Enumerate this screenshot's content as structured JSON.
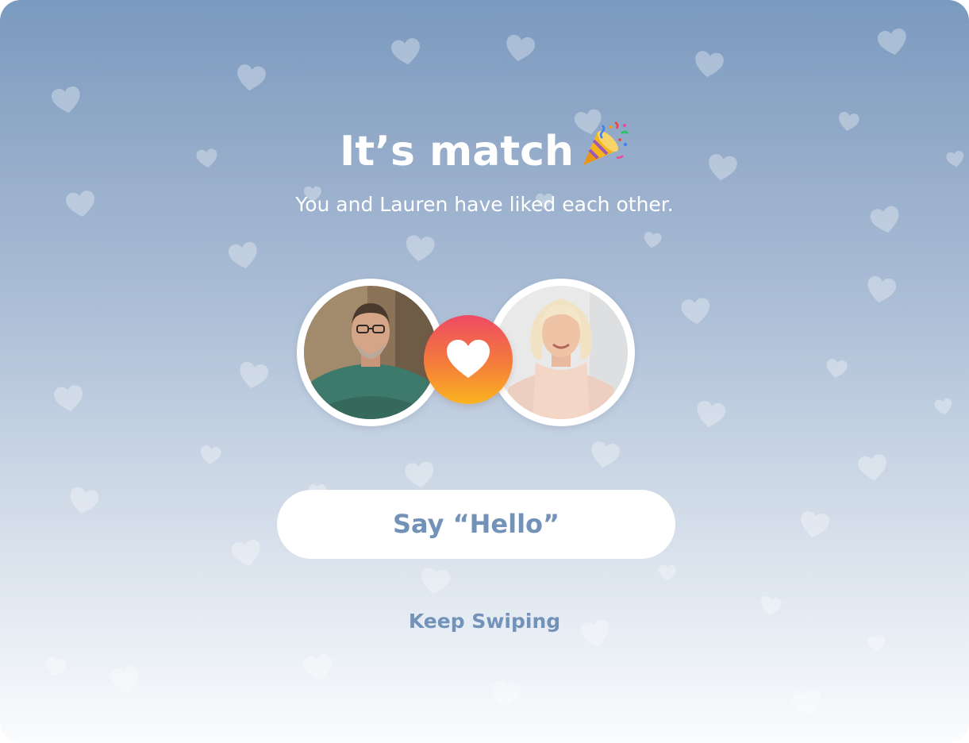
{
  "match_screen": {
    "title": "It’s match",
    "subtitle": "You and Lauren have liked each other.",
    "primary_button_label": "Say “Hello”",
    "secondary_link_label": "Keep Swiping"
  },
  "icons": {
    "title_icon": "party-popper-icon",
    "center_badge_icon": "heart-icon",
    "background_decoration": "heart-icon"
  },
  "colors": {
    "background_top": "#7a9abf",
    "background_bottom": "#fbfcfd",
    "accent_text": "#7392b8",
    "badge_gradient_top": "#ee4a64",
    "badge_gradient_bottom": "#fbb421"
  }
}
